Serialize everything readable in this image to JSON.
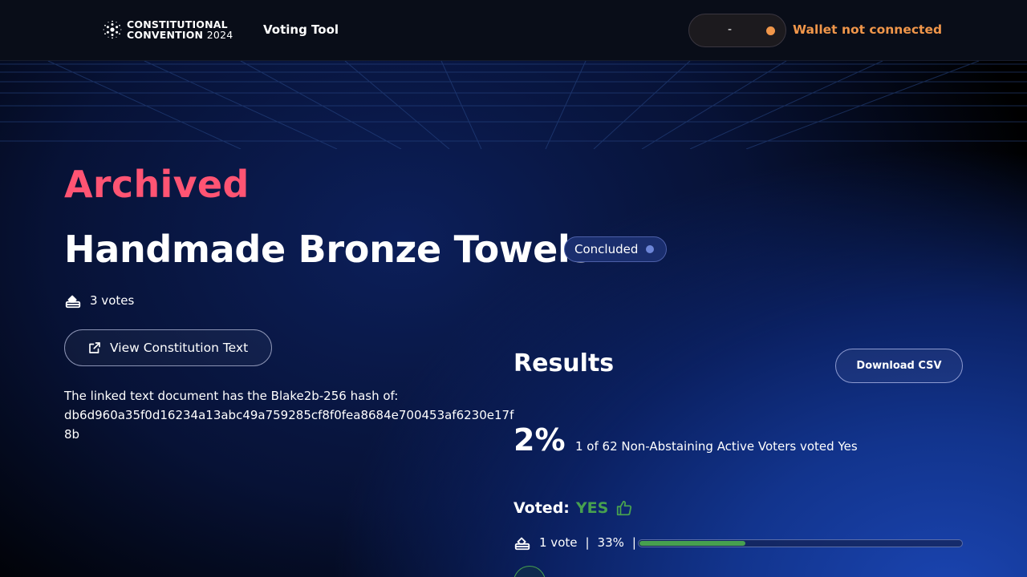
{
  "header": {
    "logo_line1": "CONSTITUTIONAL",
    "logo_line2": "CONVENTION",
    "logo_year": "2024",
    "nav_label": "Voting Tool",
    "wallet_pill_text": "-",
    "wallet_status": "Wallet not connected",
    "wallet_status_color": "#f0964a"
  },
  "page": {
    "state_label": "Archived",
    "state_color": "#ff5473",
    "title": "Handmade Bronze Towels",
    "status_badge": "Concluded",
    "votes_count": "3 votes",
    "view_button": "View Constitution Text",
    "hash_label": "The linked text document has the Blake2b-256 hash of:",
    "hash_value": "db6d960a35f0d16234a13abc49a759285cf8f0fea8684e700453af6230e17f8b"
  },
  "results": {
    "title": "Results",
    "download_button": "Download CSV",
    "percent": "2%",
    "description": "1 of 62 Non-Abstaining Active Voters voted Yes",
    "voted_label": "Voted:",
    "voted_value": "YES",
    "voted_color": "#47a04f",
    "tally_votes": "1 vote",
    "tally_separator": "|",
    "tally_percent": "33%",
    "tally_fraction": 0.33
  },
  "icons": {
    "logo": "cardano-logo-icon",
    "votes": "ballot-box-icon",
    "external": "external-link-icon",
    "thumbs": "thumbs-up-icon"
  }
}
